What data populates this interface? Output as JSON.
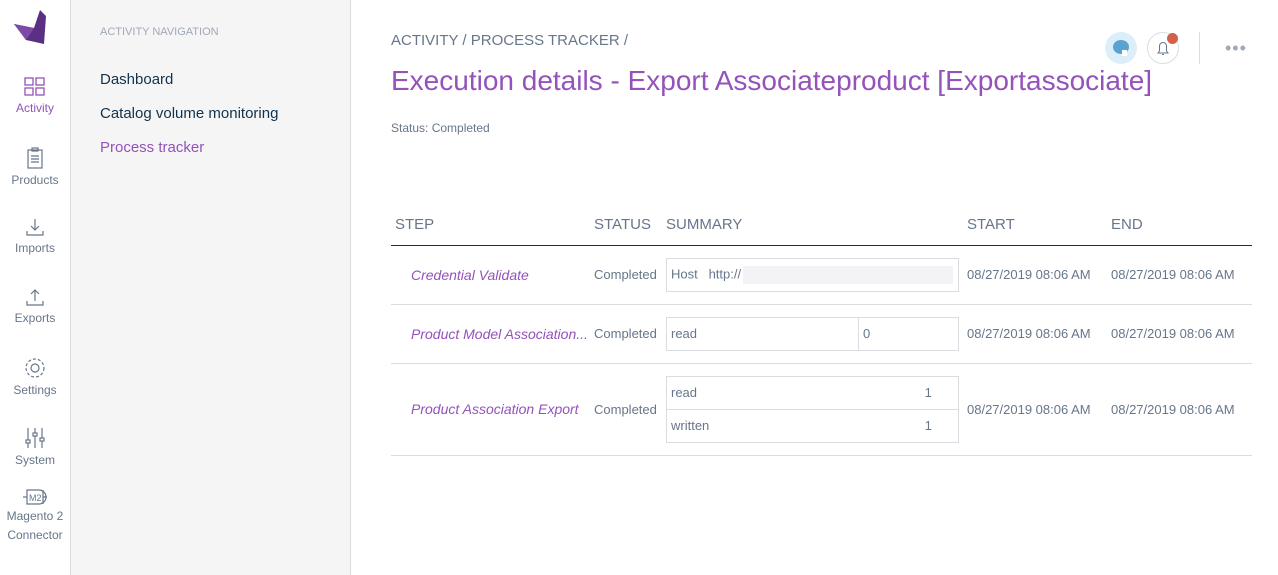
{
  "rail": [
    {
      "label": "Activity",
      "icon": "grid-icon",
      "active": true
    },
    {
      "label": "Products",
      "icon": "clipboard-icon"
    },
    {
      "label": "Imports",
      "icon": "import-icon"
    },
    {
      "label": "Exports",
      "icon": "export-icon"
    },
    {
      "label": "Settings",
      "icon": "gear-icon"
    },
    {
      "label": "System",
      "icon": "sliders-icon"
    },
    {
      "label": "Magento 2",
      "label2": "Connector",
      "icon": "m2-icon"
    }
  ],
  "panel": {
    "header": "Activity navigation",
    "items": [
      "Dashboard",
      "Catalog volume monitoring",
      "Process tracker"
    ]
  },
  "breadcrumb": "ACTIVITY / PROCESS TRACKER /",
  "title": "Execution details - Export Associateproduct [Exportassociate]",
  "status": "Status: Completed",
  "columns": [
    "Step",
    "Status",
    "Summary",
    "Start",
    "End"
  ],
  "rows": [
    {
      "step": "Credential Validate",
      "status": "Completed",
      "summary": [
        {
          "k": "Host",
          "v": "http://"
        }
      ],
      "start": "08/27/2019 08:06 AM",
      "end": "08/27/2019 08:06 AM"
    },
    {
      "step": "Product Model Association...",
      "status": "Completed",
      "summary": [
        {
          "k": "read",
          "v": "0"
        }
      ],
      "start": "08/27/2019 08:06 AM",
      "end": "08/27/2019 08:06 AM"
    },
    {
      "step": "Product Association Export",
      "status": "Completed",
      "summary": [
        {
          "k": "read",
          "v": "1"
        },
        {
          "k": "written",
          "v": "1"
        }
      ],
      "start": "08/27/2019 08:06 AM",
      "end": "08/27/2019 08:06 AM"
    }
  ],
  "colors": {
    "accent": "#9452ba",
    "notification": "#d4604a"
  }
}
